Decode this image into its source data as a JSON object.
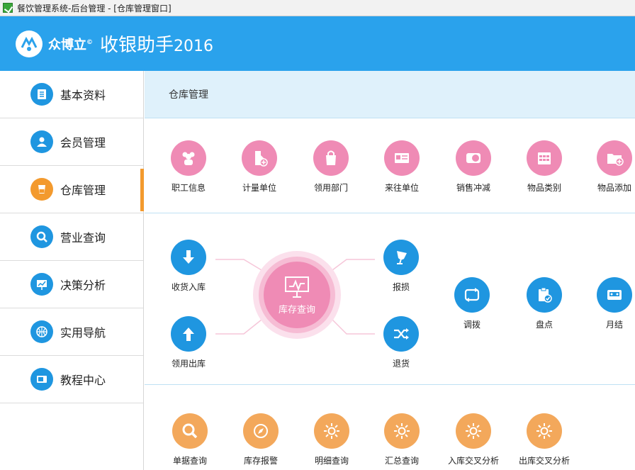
{
  "window": {
    "title": "餐饮管理系统-后台管理 - [仓库管理窗口]"
  },
  "header": {
    "brand": "众博立",
    "brand_mark": "©",
    "product": "收银助手",
    "year": "2016",
    "colors": {
      "bar": "#2aa2ec"
    }
  },
  "sidebar": {
    "items": [
      {
        "label": "基本资料",
        "icon": "notebook-icon",
        "active": false
      },
      {
        "label": "会员管理",
        "icon": "user-icon",
        "active": false
      },
      {
        "label": "仓库管理",
        "icon": "cup-icon",
        "active": true
      },
      {
        "label": "营业查询",
        "icon": "search-icon",
        "active": false
      },
      {
        "label": "决策分析",
        "icon": "chart-board-icon",
        "active": false
      },
      {
        "label": "实用导航",
        "icon": "basketball-icon",
        "active": false
      },
      {
        "label": "教程中心",
        "icon": "monitor-icon",
        "active": false
      }
    ]
  },
  "main": {
    "breadcrumb": "仓库管理",
    "row1": [
      {
        "label": "职工信息",
        "icon": "staff-icon"
      },
      {
        "label": "计量单位",
        "icon": "tag-plus-icon"
      },
      {
        "label": "领用部门",
        "icon": "bag-icon"
      },
      {
        "label": "来往单位",
        "icon": "id-card-icon"
      },
      {
        "label": "销售冲减",
        "icon": "toggle-card-icon"
      },
      {
        "label": "物品类别",
        "icon": "calendar-grid-icon"
      },
      {
        "label": "物品添加",
        "icon": "folder-plus-icon"
      }
    ],
    "row2": {
      "hub": {
        "label": "库存查询",
        "icon": "presentation-icon"
      },
      "left": [
        {
          "label": "收货入库",
          "icon": "arrow-down-icon"
        },
        {
          "label": "领用出库",
          "icon": "arrow-up-icon"
        }
      ],
      "right": [
        {
          "label": "报损",
          "icon": "broken-glass-icon"
        },
        {
          "label": "退货",
          "icon": "shuffle-icon"
        }
      ],
      "extra": [
        {
          "label": "调拨",
          "icon": "swap-icon"
        },
        {
          "label": "盘点",
          "icon": "clipboard-check-icon"
        },
        {
          "label": "月结",
          "icon": "cassette-icon"
        }
      ]
    },
    "row3": [
      {
        "label": "单据查询",
        "icon": "magnifier-icon"
      },
      {
        "label": "库存报警",
        "icon": "compass-icon"
      },
      {
        "label": "明细查询",
        "icon": "sun-icon"
      },
      {
        "label": "汇总查询",
        "icon": "sun-icon"
      },
      {
        "label": "入库交叉分析",
        "icon": "sun-icon"
      },
      {
        "label": "出库交叉分析",
        "icon": "sun-icon"
      }
    ]
  }
}
